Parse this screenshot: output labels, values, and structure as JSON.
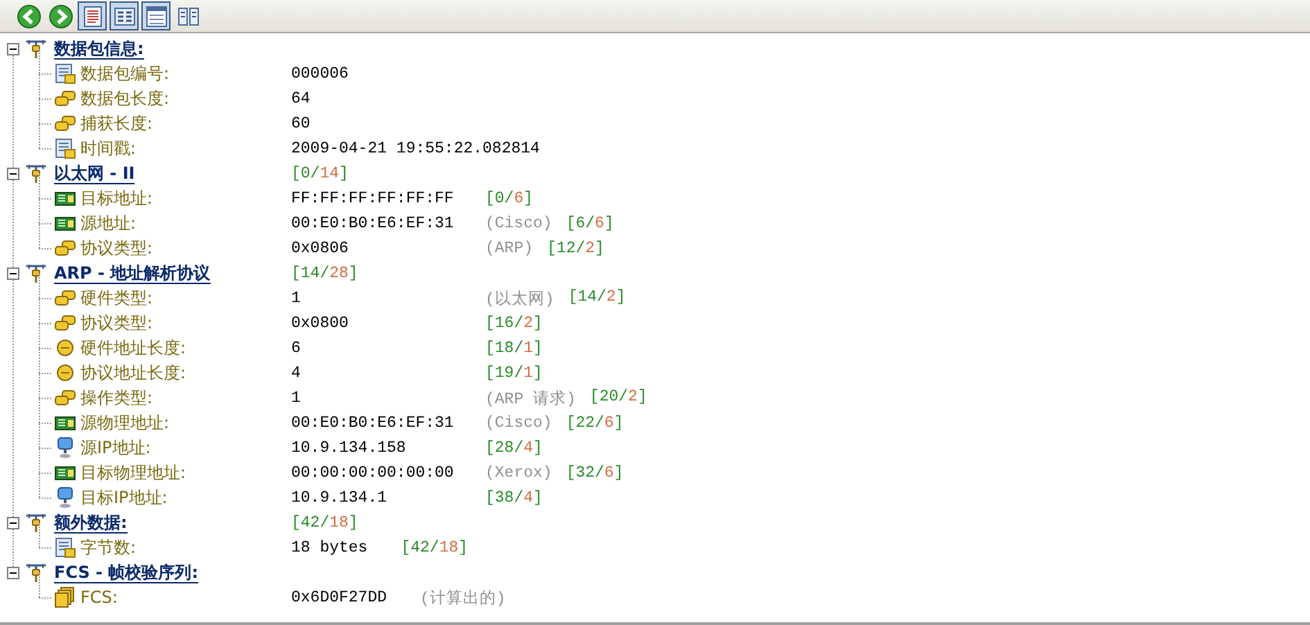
{
  "toolbar": {
    "buttons": [
      {
        "kind": "back"
      },
      {
        "kind": "forward"
      },
      {
        "kind": "doc",
        "selected": true
      },
      {
        "kind": "hex",
        "selected": true
      },
      {
        "kind": "list",
        "selected": true
      },
      {
        "kind": "columns",
        "selected": false
      }
    ]
  },
  "sections": [
    {
      "title": "数据包信息:",
      "expanded": true,
      "fields": [
        {
          "kind": "number",
          "label": "数据包编号:",
          "value": "000006"
        },
        {
          "kind": "size",
          "label": "数据包长度:",
          "value": "64"
        },
        {
          "kind": "size",
          "label": "捕获长度:",
          "value": "60"
        },
        {
          "kind": "timestamp",
          "label": "时间戳:",
          "value": "2009-04-21 19:55:22.082814"
        }
      ]
    },
    {
      "title": "以太网 - II",
      "expanded": true,
      "range": {
        "start": "[0/",
        "length": "14",
        "end": "]"
      },
      "fields": [
        {
          "kind": "mac",
          "label": "目标地址:",
          "value": "FF:FF:FF:FF:FF:FF",
          "range": {
            "start": "[0/",
            "length": "6",
            "end": "]"
          }
        },
        {
          "kind": "mac",
          "label": "源地址:",
          "value": "00:E0:B0:E6:EF:31",
          "note": "(Cisco)",
          "range": {
            "start": "[6/",
            "length": "6",
            "end": "]"
          }
        },
        {
          "kind": "type",
          "label": "协议类型:",
          "value": "0x0806",
          "note": "(ARP)",
          "range": {
            "start": "[12/",
            "length": "2",
            "end": "]"
          }
        }
      ]
    },
    {
      "title": "ARP - 地址解析协议",
      "expanded": true,
      "range": {
        "start": "[14/",
        "length": "28",
        "end": "]"
      },
      "fields": [
        {
          "kind": "type",
          "label": "硬件类型:",
          "value": "1",
          "note": "(以太网)",
          "range": {
            "start": "[14/",
            "length": "2",
            "end": "]"
          }
        },
        {
          "kind": "type",
          "label": "协议类型:",
          "value": "0x0800",
          "range": {
            "start": "[16/",
            "length": "2",
            "end": "]"
          }
        },
        {
          "kind": "length",
          "label": "硬件地址长度:",
          "value": "6",
          "range": {
            "start": "[18/",
            "length": "1",
            "end": "]"
          }
        },
        {
          "kind": "length",
          "label": "协议地址长度:",
          "value": "4",
          "range": {
            "start": "[19/",
            "length": "1",
            "end": "]"
          }
        },
        {
          "kind": "type",
          "label": "操作类型:",
          "value": "1",
          "note": "(ARP 请求)",
          "range": {
            "start": "[20/",
            "length": "2",
            "end": "]"
          }
        },
        {
          "kind": "mac",
          "label": "源物理地址:",
          "value": "00:E0:B0:E6:EF:31",
          "note": "(Cisco)",
          "range": {
            "start": "[22/",
            "length": "6",
            "end": "]"
          }
        },
        {
          "kind": "ip",
          "label": "源IP地址:",
          "value": "10.9.134.158",
          "range": {
            "start": "[28/",
            "length": "4",
            "end": "]"
          }
        },
        {
          "kind": "mac",
          "label": "目标物理地址:",
          "value": "00:00:00:00:00:00",
          "note": "(Xerox)",
          "range": {
            "start": "[32/",
            "length": "6",
            "end": "]"
          }
        },
        {
          "kind": "ip",
          "label": "目标IP地址:",
          "value": "10.9.134.1",
          "range": {
            "start": "[38/",
            "length": "4",
            "end": "]"
          }
        }
      ]
    },
    {
      "title": "额外数据:",
      "expanded": true,
      "range": {
        "start": "[42/",
        "length": "18",
        "end": "]"
      },
      "fields": [
        {
          "kind": "count",
          "label": "字节数:",
          "value": "18 bytes",
          "range": {
            "start": "[42/",
            "length": "18",
            "end": "]"
          }
        }
      ]
    },
    {
      "title": "FCS - 帧校验序列:",
      "expanded": true,
      "fields": [
        {
          "kind": "checksum",
          "label": "FCS:",
          "value": "0x6D0F27DD",
          "note": "(计算出的)"
        }
      ]
    }
  ]
}
